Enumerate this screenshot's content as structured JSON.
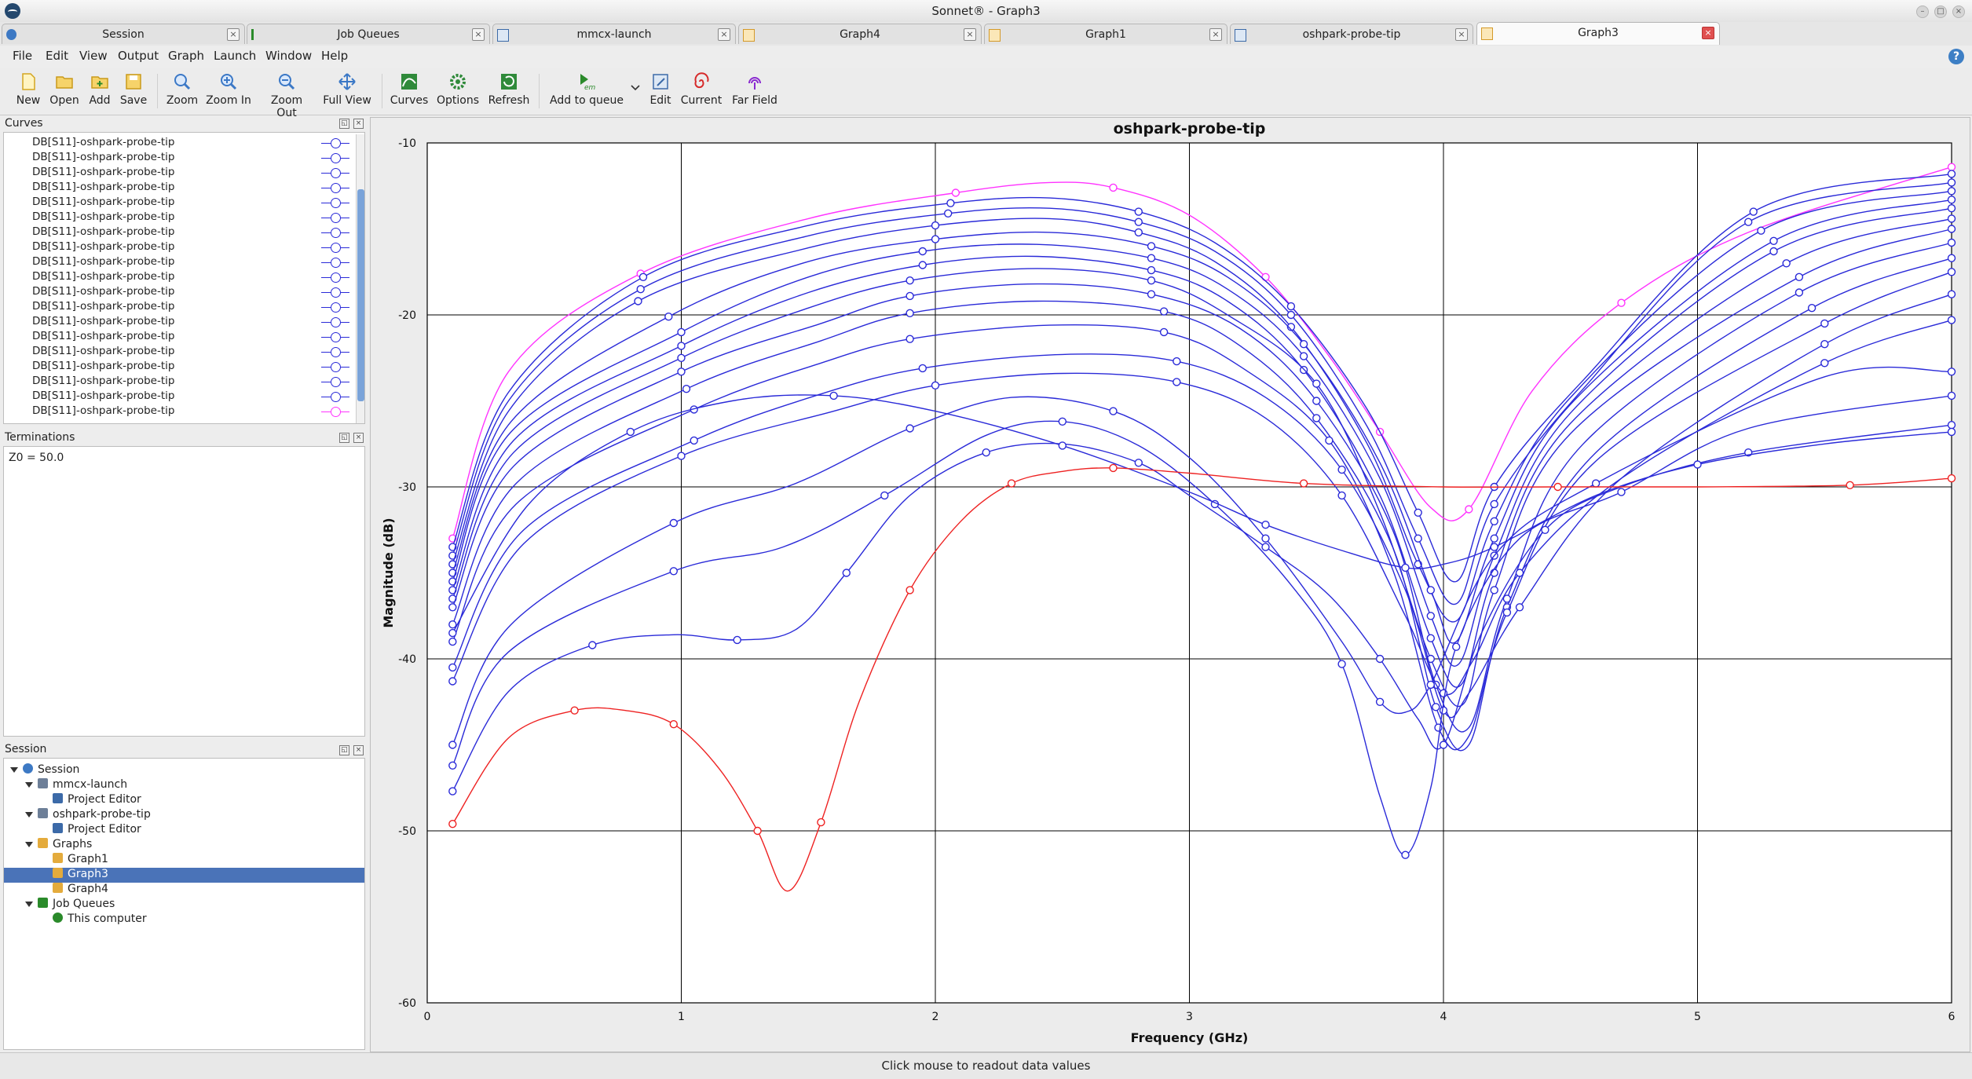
{
  "window": {
    "title": "Sonnet® - Graph3"
  },
  "tabs": [
    {
      "label": "Session"
    },
    {
      "label": "Job Queues"
    },
    {
      "label": "mmcx-launch"
    },
    {
      "label": "Graph4"
    },
    {
      "label": "Graph1"
    },
    {
      "label": "oshpark-probe-tip"
    },
    {
      "label": "Graph3",
      "active": true
    }
  ],
  "menu": [
    "File",
    "Edit",
    "View",
    "Output",
    "Graph",
    "Launch",
    "Window",
    "Help"
  ],
  "toolbar": [
    {
      "label": "New",
      "icon": "new-icon"
    },
    {
      "label": "Open",
      "icon": "open-icon"
    },
    {
      "label": "Add",
      "icon": "add-icon"
    },
    {
      "label": "Save",
      "icon": "save-icon"
    },
    {
      "label": "Zoom",
      "icon": "zoom-icon"
    },
    {
      "label": "Zoom In",
      "icon": "zoom-in-icon"
    },
    {
      "label": "Zoom Out",
      "icon": "zoom-out-icon"
    },
    {
      "label": "Full View",
      "icon": "full-view-icon"
    },
    {
      "label": "Curves",
      "icon": "curves-icon"
    },
    {
      "label": "Options",
      "icon": "options-icon"
    },
    {
      "label": "Refresh",
      "icon": "refresh-icon"
    },
    {
      "label": "Add to queue",
      "icon": "em-icon"
    },
    {
      "label": "Edit",
      "icon": "edit-icon"
    },
    {
      "label": "Current",
      "icon": "current-icon"
    },
    {
      "label": "Far Field",
      "icon": "far-field-icon"
    }
  ],
  "curves_panel": {
    "title": "Curves",
    "items": [
      "DB[S11]-oshpark-probe-tip",
      "DB[S11]-oshpark-probe-tip",
      "DB[S11]-oshpark-probe-tip",
      "DB[S11]-oshpark-probe-tip",
      "DB[S11]-oshpark-probe-tip",
      "DB[S11]-oshpark-probe-tip",
      "DB[S11]-oshpark-probe-tip",
      "DB[S11]-oshpark-probe-tip",
      "DB[S11]-oshpark-probe-tip",
      "DB[S11]-oshpark-probe-tip",
      "DB[S11]-oshpark-probe-tip",
      "DB[S11]-oshpark-probe-tip",
      "DB[S11]-oshpark-probe-tip",
      "DB[S11]-oshpark-probe-tip",
      "DB[S11]-oshpark-probe-tip",
      "DB[S11]-oshpark-probe-tip",
      "DB[S11]-oshpark-probe-tip",
      "DB[S11]-oshpark-probe-tip",
      "DB[S11]-oshpark-probe-tip"
    ],
    "last_item_color": "#ff33ff"
  },
  "terminations_panel": {
    "title": "Terminations",
    "text": "Z0 = 50.0"
  },
  "session_panel": {
    "title": "Session",
    "tree": [
      {
        "label": "Session",
        "level": 0,
        "icon": "session-icon"
      },
      {
        "label": "mmcx-launch",
        "level": 1,
        "icon": "project-icon"
      },
      {
        "label": "Project Editor",
        "level": 2,
        "icon": "editor-icon"
      },
      {
        "label": "oshpark-probe-tip",
        "level": 1,
        "icon": "project-icon"
      },
      {
        "label": "Project Editor",
        "level": 2,
        "icon": "editor-icon"
      },
      {
        "label": "Graphs",
        "level": 1,
        "icon": "graph-folder-icon"
      },
      {
        "label": "Graph1",
        "level": 2,
        "icon": "graph-icon"
      },
      {
        "label": "Graph3",
        "level": 2,
        "icon": "graph-icon",
        "selected": true
      },
      {
        "label": "Graph4",
        "level": 2,
        "icon": "graph-icon"
      },
      {
        "label": "Job Queues",
        "level": 1,
        "icon": "queue-icon"
      },
      {
        "label": "This computer",
        "level": 2,
        "icon": "check-icon"
      }
    ]
  },
  "status": "Click mouse to readout data values",
  "chart_data": {
    "type": "line",
    "title": "oshpark-probe-tip",
    "xlabel": "Frequency (GHz)",
    "ylabel": "Magnitude (dB)",
    "xlim": [
      0,
      6
    ],
    "ylim": [
      -60,
      -10
    ],
    "xticks": [
      "0",
      "1",
      "2",
      "3",
      "4",
      "5",
      "6"
    ],
    "yticks": [
      "-10",
      "-20",
      "-30",
      "-40",
      "-50",
      "-60"
    ],
    "grid": true,
    "colors": {
      "blue": "#2a2ad8",
      "magenta": "#ff33ff",
      "red": "#ee2222"
    },
    "series": [
      {
        "color": "magenta",
        "x": [
          0.1,
          0.32,
          0.84,
          1.5,
          2.08,
          2.45,
          2.7,
          3.0,
          3.3,
          3.55,
          3.75,
          3.95,
          4.1,
          4.35,
          4.7,
          5.2,
          6.0
        ],
        "values": [
          -33,
          -23.3,
          -17.6,
          -14.4,
          -12.9,
          -12.3,
          -12.6,
          -14.2,
          -17.8,
          -22.4,
          -26.8,
          -31.2,
          -31.3,
          -24.4,
          -19.3,
          -15.2,
          -11.4
        ]
      },
      {
        "color": "blue",
        "x": [
          0.1,
          0.32,
          0.85,
          1.5,
          2.06,
          2.45,
          2.8,
          3.1,
          3.4,
          3.7,
          3.9,
          4.05,
          4.2,
          4.55,
          5.22,
          6.0
        ],
        "values": [
          -33.5,
          -24.5,
          -17.8,
          -14.8,
          -13.5,
          -13.2,
          -14.0,
          -15.8,
          -19.5,
          -25.5,
          -31.5,
          -35.5,
          -30.0,
          -23.8,
          -14.0,
          -11.8
        ]
      },
      {
        "color": "blue",
        "x": [
          0.1,
          0.32,
          0.84,
          1.5,
          2.05,
          2.45,
          2.8,
          3.1,
          3.4,
          3.7,
          3.9,
          4.05,
          4.2,
          4.55,
          5.2,
          6.0
        ],
        "values": [
          -34,
          -25,
          -18.5,
          -15.4,
          -14.1,
          -13.8,
          -14.6,
          -16.3,
          -20.0,
          -26.5,
          -33.0,
          -36.8,
          -31.0,
          -24.3,
          -14.6,
          -12.3
        ]
      },
      {
        "color": "blue",
        "x": [
          0.1,
          0.32,
          0.83,
          1.5,
          2.0,
          2.45,
          2.8,
          3.1,
          3.4,
          3.7,
          3.9,
          4.05,
          4.2,
          4.5,
          5.25,
          6.0
        ],
        "values": [
          -34.5,
          -25.6,
          -19.2,
          -16.1,
          -14.8,
          -14.4,
          -15.2,
          -16.9,
          -20.7,
          -27.5,
          -34.5,
          -37.8,
          -32.0,
          -24.8,
          -15.1,
          -12.8
        ]
      },
      {
        "color": "blue",
        "x": [
          0.1,
          0.33,
          0.95,
          1.5,
          2.0,
          2.45,
          2.85,
          3.15,
          3.45,
          3.75,
          3.95,
          4.05,
          4.2,
          4.5,
          5.3,
          6.0
        ],
        "values": [
          -35,
          -26.2,
          -20.1,
          -16.9,
          -15.6,
          -15.2,
          -16.0,
          -17.8,
          -21.7,
          -28.6,
          -36.0,
          -39.0,
          -33.0,
          -25.2,
          -15.7,
          -13.3
        ]
      },
      {
        "color": "blue",
        "x": [
          0.1,
          0.33,
          1.0,
          1.5,
          1.95,
          2.4,
          2.85,
          3.15,
          3.45,
          3.75,
          3.95,
          4.06,
          4.2,
          4.5,
          5.3,
          6.0
        ],
        "values": [
          -35.5,
          -26.8,
          -21.0,
          -17.8,
          -16.3,
          -15.9,
          -16.7,
          -18.5,
          -22.4,
          -29.5,
          -37.5,
          -40.3,
          -34.0,
          -25.7,
          -16.3,
          -13.8
        ]
      },
      {
        "color": "blue",
        "x": [
          0.1,
          0.34,
          1.0,
          1.5,
          1.95,
          2.4,
          2.85,
          3.15,
          3.45,
          3.75,
          3.95,
          4.07,
          4.2,
          4.5,
          5.35,
          6.0
        ],
        "values": [
          -36,
          -27.3,
          -21.8,
          -18.7,
          -17.1,
          -16.6,
          -17.4,
          -19.2,
          -23.2,
          -30.5,
          -38.8,
          -41.5,
          -35.0,
          -26.3,
          -17.0,
          -14.4
        ]
      },
      {
        "color": "blue",
        "x": [
          0.1,
          0.34,
          1.0,
          1.5,
          1.9,
          2.4,
          2.85,
          3.15,
          3.5,
          3.75,
          3.95,
          4.08,
          4.2,
          4.5,
          5.4,
          6.0
        ],
        "values": [
          -36.5,
          -28.0,
          -22.5,
          -19.6,
          -18.0,
          -17.3,
          -18.0,
          -20.0,
          -24.0,
          -31.5,
          -40.0,
          -42.6,
          -36.0,
          -26.9,
          -17.8,
          -15.0
        ]
      },
      {
        "color": "blue",
        "x": [
          0.1,
          0.34,
          1.0,
          1.55,
          1.9,
          2.4,
          2.85,
          3.2,
          3.5,
          3.8,
          3.97,
          4.1,
          4.25,
          4.55,
          5.4,
          6.0
        ],
        "values": [
          -37,
          -28.8,
          -23.3,
          -20.5,
          -18.9,
          -18.2,
          -18.8,
          -20.8,
          -25.0,
          -32.5,
          -41.5,
          -44.0,
          -36.5,
          -27.5,
          -18.7,
          -15.8
        ]
      },
      {
        "color": "blue",
        "x": [
          0.1,
          0.35,
          1.02,
          1.55,
          1.9,
          2.4,
          2.9,
          3.2,
          3.5,
          3.8,
          3.97,
          4.1,
          4.25,
          4.6,
          5.45,
          6.0
        ],
        "values": [
          -38,
          -29.8,
          -24.3,
          -21.5,
          -19.9,
          -19.2,
          -19.8,
          -21.8,
          -26.0,
          -33.5,
          -42.8,
          -45.0,
          -37.0,
          -28.0,
          -19.6,
          -16.7
        ]
      },
      {
        "color": "blue",
        "x": [
          0.1,
          0.35,
          1.05,
          1.55,
          1.9,
          2.45,
          2.9,
          3.2,
          3.55,
          3.8,
          3.98,
          4.1,
          4.25,
          4.6,
          5.5,
          6.0
        ],
        "values": [
          -39,
          -31,
          -25.5,
          -22.8,
          -21.4,
          -20.6,
          -21.0,
          -23.0,
          -27.3,
          -34.8,
          -44.0,
          -44.5,
          -37.3,
          -28.5,
          -20.5,
          -17.5
        ]
      },
      {
        "color": "blue",
        "x": [
          0.1,
          0.38,
          1.05,
          1.55,
          1.95,
          2.5,
          2.95,
          3.3,
          3.6,
          3.85,
          4.0,
          4.1,
          4.3,
          4.7,
          5.5,
          6.0
        ],
        "values": [
          -40.5,
          -32.5,
          -27.3,
          -24.6,
          -23.1,
          -22.3,
          -22.7,
          -24.8,
          -29.0,
          -36.0,
          -43.0,
          -42.0,
          -37.0,
          -29.5,
          -21.7,
          -18.8
        ]
      },
      {
        "color": "blue",
        "x": [
          0.1,
          0.38,
          1.0,
          1.6,
          2.0,
          2.5,
          2.95,
          3.3,
          3.6,
          3.85,
          4.0,
          4.12,
          4.3,
          4.7,
          5.5,
          6.0
        ],
        "values": [
          -41.3,
          -33.3,
          -28.2,
          -25.6,
          -24.1,
          -23.4,
          -23.9,
          -26.0,
          -30.5,
          -37.5,
          -42.0,
          -40.0,
          -35.0,
          -29.5,
          -22.8,
          -20.3
        ]
      },
      {
        "color": "blue",
        "x": [
          0.1,
          0.33,
          0.97,
          1.45,
          1.9,
          2.3,
          2.7,
          3.0,
          3.3,
          3.6,
          3.75,
          3.85,
          3.95,
          4.2,
          4.6,
          5.5,
          6.0
        ],
        "values": [
          -45,
          -38,
          -32.1,
          -29.8,
          -26.6,
          -24.8,
          -25.6,
          -28.3,
          -33.0,
          -39.0,
          -42.5,
          -43.1,
          -41.5,
          -34.0,
          -29.8,
          -23.6,
          -23.3
        ]
      },
      {
        "color": "blue",
        "x": [
          0.1,
          0.32,
          0.97,
          1.4,
          1.8,
          2.2,
          2.5,
          2.8,
          3.1,
          3.4,
          3.6,
          3.75,
          3.85,
          3.95,
          4.05,
          4.3,
          4.7,
          5.2,
          6.0
        ],
        "values": [
          -46.2,
          -39.6,
          -34.9,
          -33.5,
          -30.5,
          -27.0,
          -26.2,
          -27.6,
          -31.0,
          -35.7,
          -40.3,
          -48.0,
          -51.4,
          -47.5,
          -39.3,
          -33.0,
          -30.3,
          -26.6,
          -24.7
        ]
      },
      {
        "color": "blue",
        "x": [
          0.1,
          0.32,
          0.65,
          0.97,
          1.22,
          1.45,
          1.65,
          1.9,
          2.2,
          2.5,
          2.8,
          3.0,
          3.3,
          3.55,
          3.75,
          3.9,
          4.0,
          4.15,
          4.4,
          4.7,
          5.2,
          6.0
        ],
        "values": [
          -47.7,
          -41.9,
          -39.2,
          -38.6,
          -38.9,
          -38.3,
          -35.0,
          -30.5,
          -28.0,
          -27.5,
          -28.6,
          -30.5,
          -33.5,
          -36.3,
          -40.0,
          -43.5,
          -45.0,
          -38.5,
          -32.5,
          -30.0,
          -28.0,
          -26.4
        ]
      },
      {
        "color": "blue",
        "x": [
          0.1,
          0.4,
          0.8,
          1.2,
          1.6,
          2.0,
          2.5,
          3.0,
          3.3,
          3.6,
          3.85,
          4.0,
          4.2,
          4.6,
          5.0,
          5.5,
          6.0
        ],
        "values": [
          -38.5,
          -31,
          -26.8,
          -25,
          -24.7,
          -25.6,
          -27.6,
          -30.3,
          -32.2,
          -33.7,
          -34.7,
          -34.5,
          -33.5,
          -30.5,
          -28.7,
          -27.5,
          -26.8
        ]
      },
      {
        "color": "red",
        "x": [
          0.1,
          0.32,
          0.58,
          0.78,
          0.97,
          1.15,
          1.3,
          1.42,
          1.55,
          1.7,
          1.9,
          2.1,
          2.3,
          2.5,
          2.7,
          3.0,
          3.45,
          4.0,
          4.45,
          5.0,
          5.6,
          6.0
        ],
        "values": [
          -49.6,
          -44.6,
          -43.0,
          -43.0,
          -43.8,
          -46.4,
          -50.0,
          -53.5,
          -49.5,
          -42.5,
          -36.0,
          -32.0,
          -29.8,
          -29.1,
          -28.9,
          -29.2,
          -29.8,
          -30.0,
          -30.0,
          -30.0,
          -29.9,
          -29.5
        ]
      }
    ]
  }
}
